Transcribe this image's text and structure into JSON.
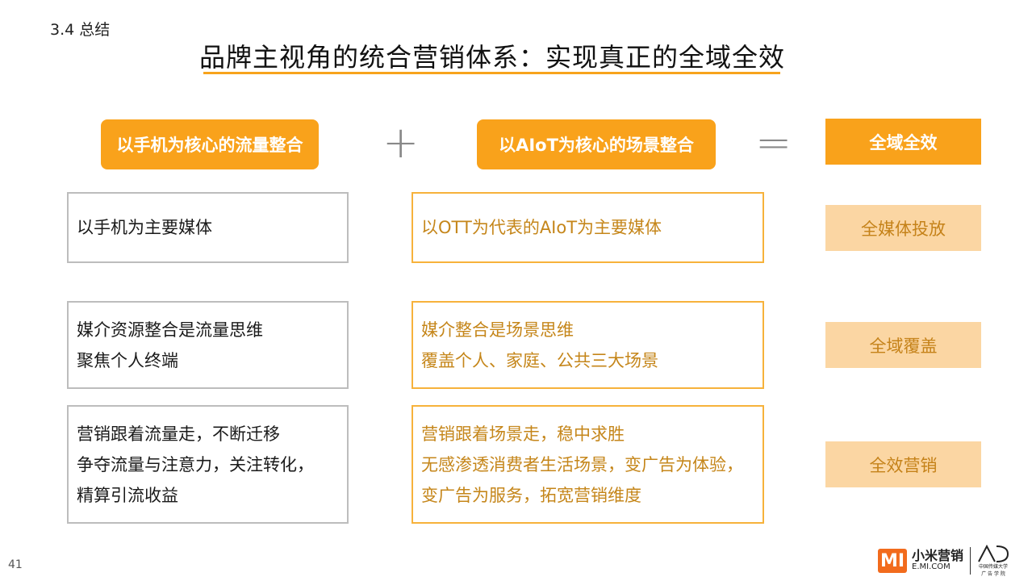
{
  "header": {
    "section": "3.4 总结",
    "title": "品牌主视角的统合营销体系：实现真正的全域全效"
  },
  "columns": {
    "left_header": "以手机为核心的流量整合",
    "plus": "+",
    "middle_header": "以AIoT为核心的场景整合",
    "equals": "=",
    "right_header": "全域全效"
  },
  "rows": [
    {
      "left": [
        "以手机为主要媒体"
      ],
      "middle": [
        "以OTT为代表的AIoT为主要媒体"
      ],
      "result": "全媒体投放"
    },
    {
      "left": [
        "媒介资源整合是流量思维",
        "聚焦个人终端"
      ],
      "middle": [
        "媒介整合是场景思维",
        "覆盖个人、家庭、公共三大场景"
      ],
      "result": "全域覆盖"
    },
    {
      "left": [
        "营销跟着流量走，不断迁移",
        "争夺流量与注意力，关注转化，",
        "精算引流收益"
      ],
      "middle": [
        "营销跟着场景走，稳中求胜",
        "无感渗透消费者生活场景，变广告为体验，",
        "变广告为服务，拓宽营销维度"
      ],
      "result": "全效营销"
    }
  ],
  "footer": {
    "page_number": "41",
    "brand_mark": "MI",
    "brand_cn": "小米营销",
    "brand_en": "E.MI.COM",
    "partner_mark": "AD",
    "partner_line1": "中国传媒大学",
    "partner_line2": "广 告 学 院"
  },
  "colors": {
    "accent": "#f9a21b",
    "result_bg": "#fbd6a3",
    "result_text": "#c58219",
    "orange_text": "#c5861a"
  }
}
